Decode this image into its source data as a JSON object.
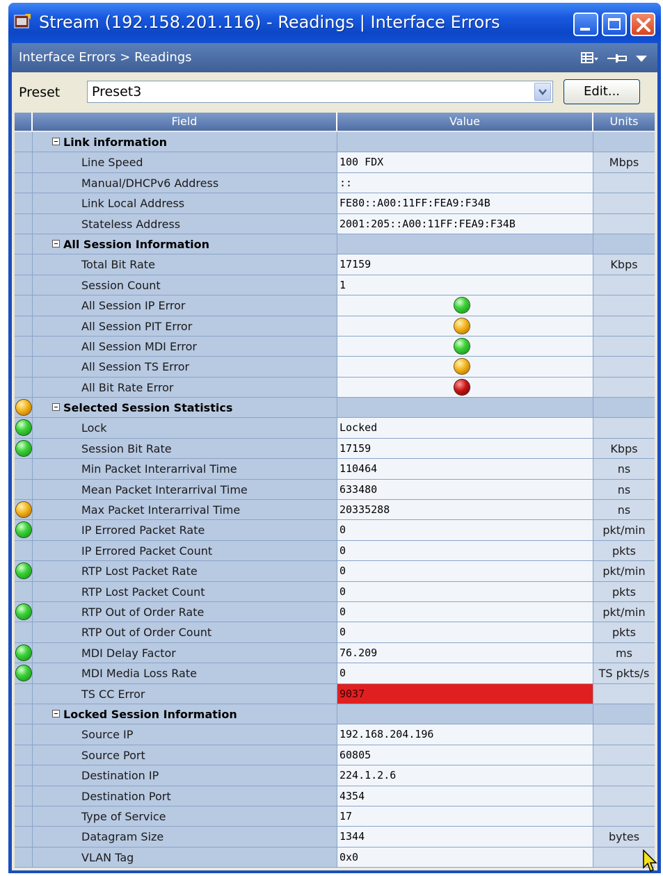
{
  "window": {
    "title": "Stream (192.158.201.116) - Readings | Interface Errors"
  },
  "breadcrumb": "Interface Errors > Readings",
  "preset": {
    "label": "Preset",
    "value": "Preset3",
    "edit_label": "Edit..."
  },
  "table": {
    "headers": {
      "field": "Field",
      "value": "Value",
      "units": "Units"
    },
    "rows": [
      {
        "type": "group",
        "field": "Link information",
        "value": "",
        "units": ""
      },
      {
        "type": "child",
        "field": "Line Speed",
        "value": "100 FDX",
        "units": "Mbps"
      },
      {
        "type": "child",
        "field": "Manual/DHCPv6 Address",
        "value": "::",
        "units": ""
      },
      {
        "type": "child",
        "field": "Link Local Address",
        "value": "FE80::A00:11FF:FEA9:F34B",
        "units": ""
      },
      {
        "type": "child",
        "field": "Stateless Address",
        "value": "2001:205::A00:11FF:FEA9:F34B",
        "units": ""
      },
      {
        "type": "group",
        "field": "All Session Information",
        "value": "",
        "units": ""
      },
      {
        "type": "child",
        "field": "Total Bit Rate",
        "value": "17159",
        "units": "Kbps"
      },
      {
        "type": "child",
        "field": "Session Count",
        "value": "1",
        "units": ""
      },
      {
        "type": "child",
        "field": "All Session IP Error",
        "value": "",
        "value_led": "green",
        "units": ""
      },
      {
        "type": "child",
        "field": "All Session PIT Error",
        "value": "",
        "value_led": "orange",
        "units": ""
      },
      {
        "type": "child",
        "field": "All Session MDI Error",
        "value": "",
        "value_led": "green",
        "units": ""
      },
      {
        "type": "child",
        "field": "All Session TS Error",
        "value": "",
        "value_led": "orange",
        "units": ""
      },
      {
        "type": "child",
        "field": "All Bit Rate Error",
        "value": "",
        "value_led": "red",
        "units": ""
      },
      {
        "type": "group",
        "field": "Selected Session Statistics",
        "value": "",
        "units": "",
        "status": "orange"
      },
      {
        "type": "child",
        "field": "Lock",
        "value": "Locked",
        "units": "",
        "status": "green"
      },
      {
        "type": "child",
        "field": "Session Bit Rate",
        "value": "17159",
        "units": "Kbps",
        "status": "green"
      },
      {
        "type": "child",
        "field": "Min Packet Interarrival Time",
        "value": "110464",
        "units": "ns"
      },
      {
        "type": "child",
        "field": "Mean Packet Interarrival Time",
        "value": "633480",
        "units": "ns"
      },
      {
        "type": "child",
        "field": "Max Packet Interarrival Time",
        "value": "20335288",
        "units": "ns",
        "status": "orange"
      },
      {
        "type": "child",
        "field": "IP Errored Packet Rate",
        "value": "0",
        "units": "pkt/min",
        "status": "green"
      },
      {
        "type": "child",
        "field": "IP Errored Packet Count",
        "value": "0",
        "units": "pkts"
      },
      {
        "type": "child",
        "field": "RTP Lost Packet Rate",
        "value": "0",
        "units": "pkt/min",
        "status": "green"
      },
      {
        "type": "child",
        "field": "RTP Lost Packet Count",
        "value": "0",
        "units": "pkts"
      },
      {
        "type": "child",
        "field": "RTP Out of Order Rate",
        "value": "0",
        "units": "pkt/min",
        "status": "green"
      },
      {
        "type": "child",
        "field": "RTP Out of Order Count",
        "value": "0",
        "units": "pkts"
      },
      {
        "type": "child",
        "field": "MDI Delay Factor",
        "value": "76.209",
        "units": "ms",
        "status": "green"
      },
      {
        "type": "child",
        "field": "MDI Media Loss Rate",
        "value": "0",
        "units": "TS pkts/s",
        "status": "green"
      },
      {
        "type": "child",
        "field": "TS CC Error",
        "value": "9037",
        "units": "",
        "highlight": "#e02020"
      },
      {
        "type": "group",
        "field": "Locked Session Information",
        "value": "",
        "units": ""
      },
      {
        "type": "child",
        "field": "Source IP",
        "value": "192.168.204.196",
        "units": ""
      },
      {
        "type": "child",
        "field": "Source Port",
        "value": "60805",
        "units": ""
      },
      {
        "type": "child",
        "field": "Destination IP",
        "value": "224.1.2.6",
        "units": ""
      },
      {
        "type": "child",
        "field": "Destination Port",
        "value": "4354",
        "units": ""
      },
      {
        "type": "child",
        "field": "Type of Service",
        "value": "17",
        "units": ""
      },
      {
        "type": "child",
        "field": "Datagram Size",
        "value": "1344",
        "units": "bytes"
      },
      {
        "type": "child",
        "field": "VLAN Tag",
        "value": "0x0",
        "units": ""
      }
    ]
  }
}
